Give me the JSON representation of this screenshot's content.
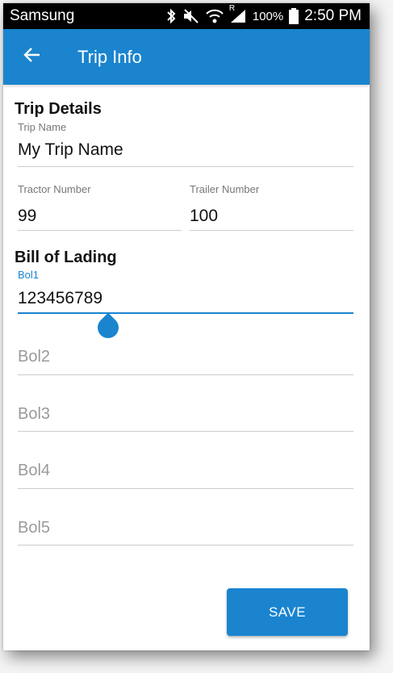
{
  "status_bar": {
    "carrier": "Samsung",
    "battery": "100%",
    "roaming_indicator": "R",
    "time": "2:50 PM"
  },
  "app_bar": {
    "title": "Trip Info",
    "back_icon": "arrow-left-icon"
  },
  "trip_details": {
    "heading": "Trip Details",
    "trip_name": {
      "label": "Trip Name",
      "value": "My Trip Name"
    },
    "tractor_number": {
      "label": "Tractor Number",
      "value": "99"
    },
    "trailer_number": {
      "label": "Trailer Number",
      "value": "100"
    }
  },
  "bill_of_lading": {
    "heading": "Bill of Lading",
    "bol1": {
      "label": "Bol1",
      "value": "123456789",
      "focused": true
    },
    "bol2": {
      "placeholder": "Bol2",
      "value": ""
    },
    "bol3": {
      "placeholder": "Bol3",
      "value": ""
    },
    "bol4": {
      "placeholder": "Bol4",
      "value": ""
    },
    "bol5": {
      "placeholder": "Bol5",
      "value": ""
    }
  },
  "actions": {
    "save_label": "SAVE"
  },
  "colors": {
    "primary": "#1a84cf",
    "status_bar": "#000000",
    "underline": "#cccccc",
    "label_text": "#777777",
    "placeholder_text": "#9a9a9a"
  }
}
